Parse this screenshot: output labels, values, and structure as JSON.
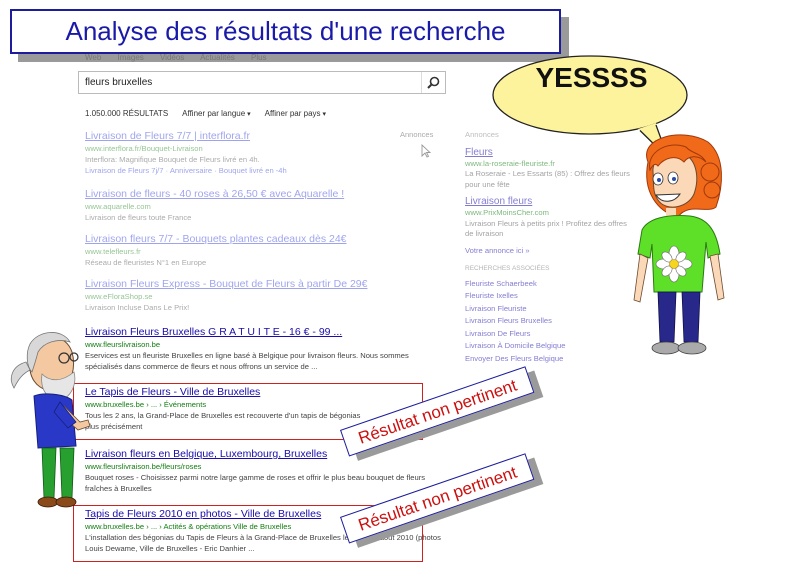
{
  "title": "Analyse des résultats d'une recherche",
  "bubble": "YESSSS",
  "nav": "Web Images Vidéos Actualités Plus",
  "search": {
    "query": "fleurs bruxelles"
  },
  "stats": {
    "count": "1.050.000 RÉSULTATS",
    "filter_lang": "Affiner par langue",
    "filter_country": "Affiner par pays"
  },
  "ads_label": "Annonces",
  "ads": [
    {
      "title": "Livraison de Fleurs 7/7 | interflora.fr",
      "url": "www.interflora.fr/Bouquet-Livraison",
      "snippet": "Interflora: Magnifique Bouquet de Fleurs livré en 4h.",
      "snippet2": "Livraison de Fleurs 7j/7 · Anniversaire · Bouquet livré en -4h"
    },
    {
      "title": "Livraison de fleurs - 40 roses à 26,50 € avec Aquarelle !",
      "url": "www.aquarelle.com",
      "snippet": "Livraison de fleurs toute France"
    },
    {
      "title": "Livraison fleurs 7/7 - Bouquets plantes cadeaux dès 24€",
      "url": "www.telefleurs.fr",
      "snippet": "Réseau de fleuristes N°1 en Europe"
    },
    {
      "title": "Livraison Fleurs Express - Bouquet de Fleurs à partir De 29€",
      "url": "www.eFloraShop.se",
      "snippet": "Livraison Incluse Dans Le Prix!"
    }
  ],
  "results": [
    {
      "title": "Livraison Fleurs Bruxelles G R A T U I T E - 16 € - 99 ...",
      "url": "www.fleurslivraison.be",
      "snippet": "Eservices est un fleuriste Bruxelles en ligne basé à Belgique pour livraison fleurs. Nous sommes spécialisés dans commerce de fleurs et nous offrons un service de ..."
    },
    {
      "title": "Le Tapis de Fleurs - Ville de Bruxelles",
      "url": "www.bruxelles.be › ... › Événements",
      "snippet": "Tous les 2 ans, la Grand-Place de Bruxelles est recouverte d'un tapis de bégonias plus précisément"
    },
    {
      "title": "Livraison fleurs en Belgique, Luxembourg, Bruxelles",
      "url": "www.fleurslivraison.be/fleurs/roses",
      "snippet": "Bouquet roses - Choisissez parmi notre large gamme de roses et offrir le plus beau bouquet de fleurs fraîches à Bruxelles"
    },
    {
      "title": "Tapis de Fleurs 2010 en photos - Ville de Bruxelles",
      "url": "www.bruxelles.be › ... › Actités & opérations Ville de Bruxelles",
      "snippet": "L'installation des bégonias du Tapis de Fleurs à la Grand-Place de Bruxelles le jeudi 12 août 2010 (photos Louis Dewame, Ville de Bruxelles - Eric Danhier ..."
    }
  ],
  "sidebar": {
    "ann": "Annonces",
    "ad1_title": "Fleurs",
    "ad1_url": "www.la-roseraie-fleuriste.fr",
    "ad1_snip": "La Roseraie - Les Essarts (85) : Offrez des fleurs pour une fête",
    "ad2_title": "Livraison fleurs",
    "ad2_url": "www.PrixMoinsCher.com",
    "ad2_snip": "Livraison Fleurs à petits prix ! Profitez des offres de livraison",
    "ad_link": "Votre annonce ici »",
    "related_head": "RECHERCHES ASSOCIÉES",
    "related": [
      "Fleuriste Schaerbeek",
      "Fleuriste Ixelles",
      "Livraison Fleuriste",
      "Livraison Fleurs Bruxelles",
      "Livraison De Fleurs",
      "Livraison À Domicile Belgique",
      "Envoyer Des Fleurs Belgique"
    ]
  },
  "labels": {
    "non_pertinent_1": "Résultat non pertinent",
    "non_pertinent_2": "Résultat non pertinent"
  },
  "colors": {
    "title_blue": "#1a1aa8",
    "red": "#d02020",
    "link": "#1a0dab",
    "url_green": "#117d11",
    "bubble": "#fdf39c"
  }
}
